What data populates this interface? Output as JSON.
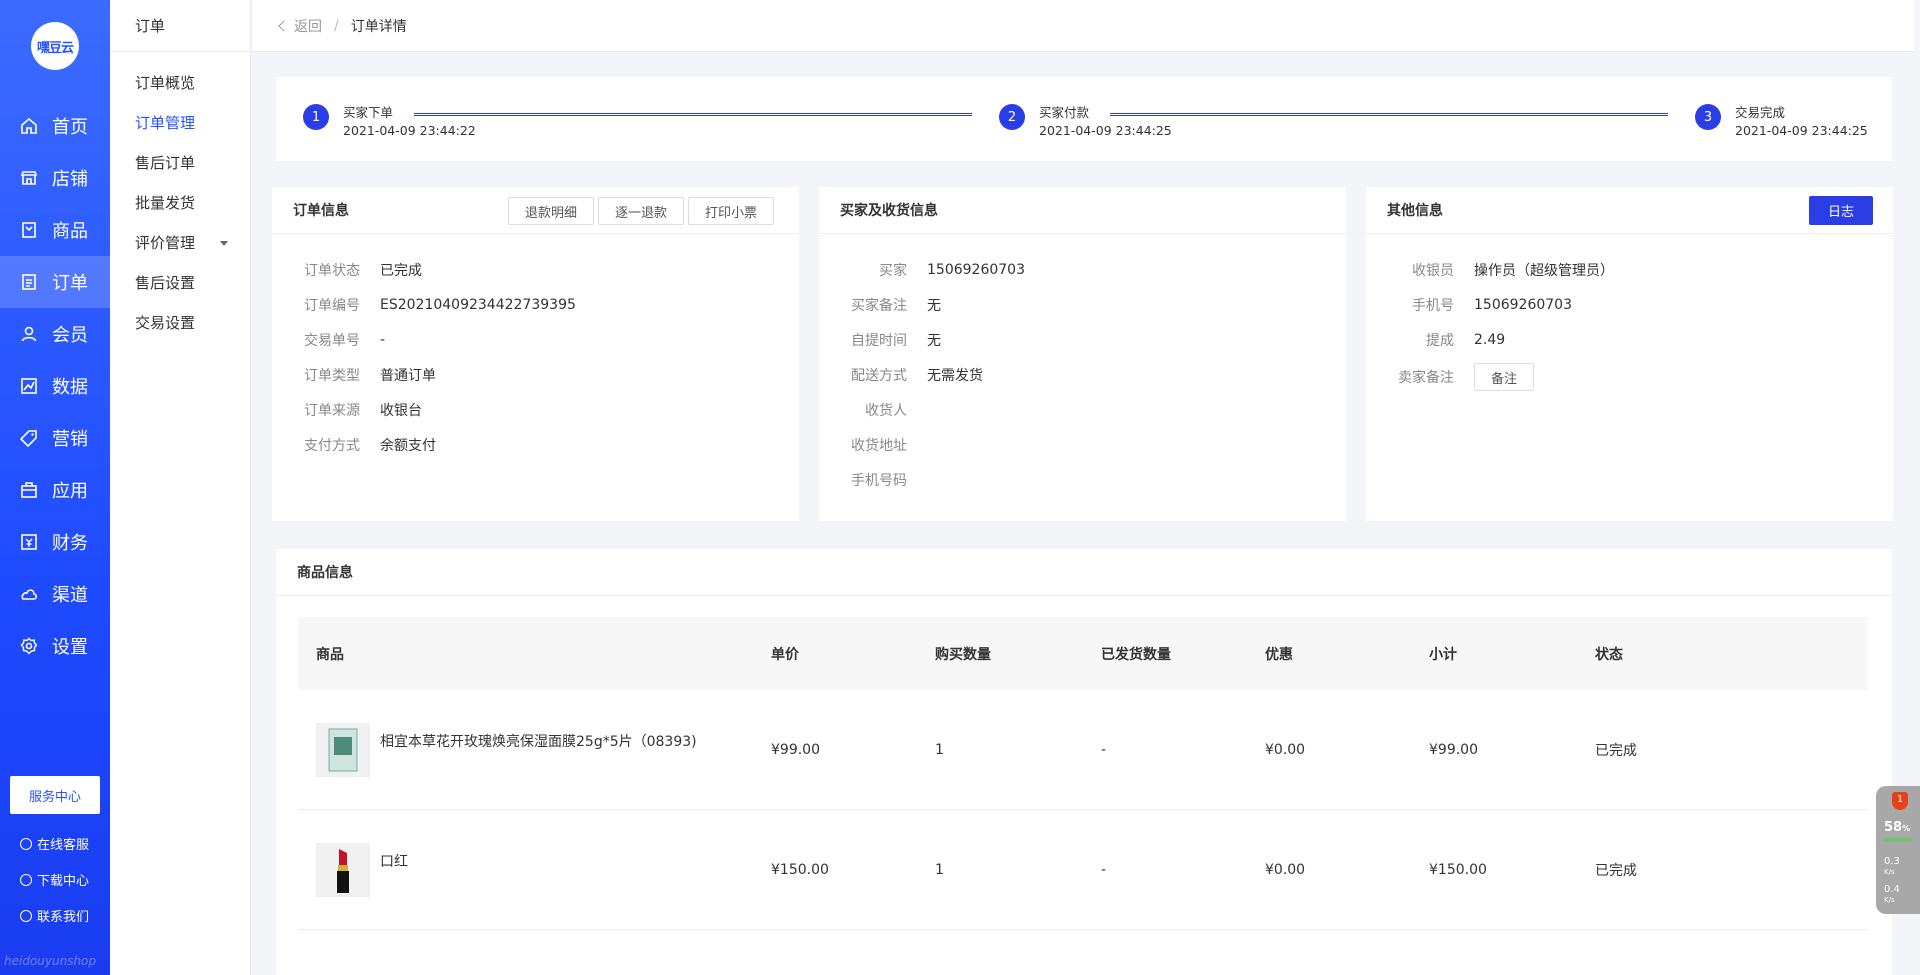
{
  "brand": {
    "logo_text": "嘿豆云",
    "footer_text": "heidouyunshop"
  },
  "nav": [
    {
      "label": "首页",
      "icon": "home-icon"
    },
    {
      "label": "店铺",
      "icon": "store-icon"
    },
    {
      "label": "商品",
      "icon": "goods-icon"
    },
    {
      "label": "订单",
      "icon": "order-icon"
    },
    {
      "label": "会员",
      "icon": "member-icon"
    },
    {
      "label": "数据",
      "icon": "chart-icon"
    },
    {
      "label": "营销",
      "icon": "tag-icon"
    },
    {
      "label": "应用",
      "icon": "app-icon"
    },
    {
      "label": "财务",
      "icon": "finance-icon"
    },
    {
      "label": "渠道",
      "icon": "channel-icon"
    },
    {
      "label": "设置",
      "icon": "gear-icon"
    }
  ],
  "side_footer": {
    "service_center": "服务中心",
    "online_service": "在线客服",
    "download_center": "下载中心",
    "contact_us": "联系我们"
  },
  "subnav": {
    "title": "订单",
    "items": [
      "订单概览",
      "订单管理",
      "售后订单",
      "批量发货",
      "评价管理",
      "售后设置",
      "交易设置"
    ]
  },
  "breadcrumb": {
    "back": "返回",
    "separator": "/",
    "current": "订单详情"
  },
  "steps": [
    {
      "num": "1",
      "label": "买家下单",
      "time": "2021-04-09 23:44:22"
    },
    {
      "num": "2",
      "label": "买家付款",
      "time": "2021-04-09 23:44:25"
    },
    {
      "num": "3",
      "label": "交易完成",
      "time": "2021-04-09 23:44:25"
    }
  ],
  "order_info": {
    "title": "订单信息",
    "buttons": [
      "退款明细",
      "逐一退款",
      "打印小票"
    ],
    "rows": [
      {
        "k": "订单状态",
        "v": "已完成"
      },
      {
        "k": "订单编号",
        "v": "ES20210409234422739395"
      },
      {
        "k": "交易单号",
        "v": "-"
      },
      {
        "k": "订单类型",
        "v": "普通订单"
      },
      {
        "k": "订单来源",
        "v": "收银台"
      },
      {
        "k": "支付方式",
        "v": "余额支付"
      }
    ]
  },
  "buyer_info": {
    "title": "买家及收货信息",
    "rows": [
      {
        "k": "买家",
        "v": "15069260703"
      },
      {
        "k": "买家备注",
        "v": "无"
      },
      {
        "k": "自提时间",
        "v": "无"
      },
      {
        "k": "配送方式",
        "v": "无需发货"
      },
      {
        "k": "收货人",
        "v": ""
      },
      {
        "k": "收货地址",
        "v": ""
      },
      {
        "k": "手机号码",
        "v": ""
      }
    ]
  },
  "other_info": {
    "title": "其他信息",
    "log_button": "日志",
    "rows": [
      {
        "k": "收银员",
        "v": "操作员（超级管理员）"
      },
      {
        "k": "手机号",
        "v": "15069260703"
      },
      {
        "k": "提成",
        "v": "2.49"
      }
    ],
    "remark_label": "卖家备注",
    "remark_button": "备注"
  },
  "goods": {
    "title": "商品信息",
    "headers": [
      "商品",
      "单价",
      "购买数量",
      "已发货数量",
      "优惠",
      "小计",
      "状态"
    ],
    "rows": [
      {
        "name": "相宜本草花开玫瑰焕亮保湿面膜25g*5片（08393)",
        "price": "¥99.00",
        "qty": "1",
        "shipped": "-",
        "discount": "¥0.00",
        "subtotal": "¥99.00",
        "status": "已完成"
      },
      {
        "name": "口红",
        "price": "¥150.00",
        "qty": "1",
        "shipped": "-",
        "discount": "¥0.00",
        "subtotal": "¥150.00",
        "status": "已完成"
      }
    ]
  },
  "widget": {
    "badge": "1",
    "percent": "58",
    "percent_unit": "%",
    "up": "0.3",
    "up_unit": "K/s",
    "down": "0.4",
    "down_unit": "K/s"
  },
  "colors": {
    "primary": "#2b3ee6",
    "sidebar": "#2453ff",
    "success": "#3cb44b"
  }
}
